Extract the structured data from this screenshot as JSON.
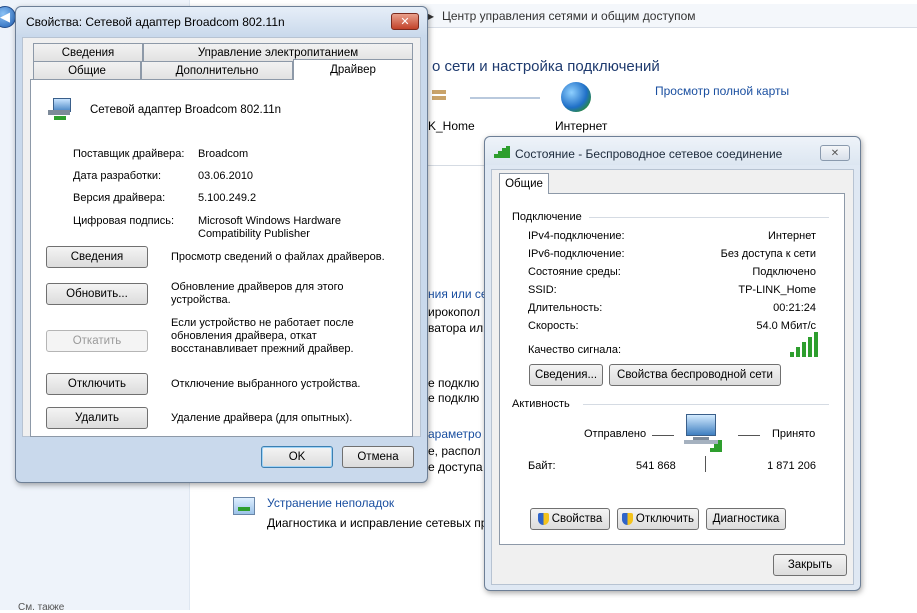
{
  "background": {
    "breadcrumb": "Центр управления сетями и общим доступом",
    "heading": "о сети и настройка подключений",
    "map_link": "Просмотр полной карты",
    "node_home": "K_Home",
    "node_internet": "Интернет",
    "frag1": "ния или се",
    "frag2": "ирокопол",
    "frag3": "ватора ил",
    "frag4": "е подклю",
    "frag5": "е подклю",
    "frag6": "араметро",
    "frag7": "е, распол",
    "frag8": "е доступа",
    "troubleshoot_link": "Устранение неполадок",
    "troubleshoot_desc": "Диагностика и исправление сетевых пр",
    "see_also": "См. также"
  },
  "props": {
    "title": "Свойства: Сетевой адаптер Broadcom 802.11n",
    "tabs_top": [
      "Сведения",
      "Управление электропитанием"
    ],
    "tabs_bottom": [
      "Общие",
      "Дополнительно",
      "Драйвер"
    ],
    "device_name": "Сетевой адаптер Broadcom 802.11n",
    "info": [
      {
        "label": "Поставщик драйвера:",
        "value": "Broadcom"
      },
      {
        "label": "Дата разработки:",
        "value": "03.06.2010"
      },
      {
        "label": "Версия драйвера:",
        "value": "5.100.249.2"
      },
      {
        "label": "Цифровая подпись:",
        "value": "Microsoft Windows Hardware Compatibility Publisher"
      }
    ],
    "actions": [
      {
        "button": "Сведения",
        "desc": "Просмотр сведений о файлах драйверов."
      },
      {
        "button": "Обновить...",
        "desc": "Обновление драйверов для этого устройства."
      },
      {
        "button": "Откатить",
        "desc": "Если устройство не работает после обновления драйвера, откат восстанавливает прежний драйвер."
      },
      {
        "button": "Отключить",
        "desc": "Отключение выбранного устройства."
      },
      {
        "button": "Удалить",
        "desc": "Удаление драйвера (для опытных)."
      }
    ],
    "ok": "OK",
    "cancel": "Отмена",
    "close_glyph": "✕"
  },
  "status": {
    "title": "Состояние - Беспроводное сетевое соединение",
    "tab": "Общие",
    "connection_header": "Подключение",
    "rows": [
      {
        "label": "IPv4-подключение:",
        "value": "Интернет"
      },
      {
        "label": "IPv6-подключение:",
        "value": "Без доступа к сети"
      },
      {
        "label": "Состояние среды:",
        "value": "Подключено"
      },
      {
        "label": "SSID:",
        "value": "TP-LINK_Home"
      },
      {
        "label": "Длительность:",
        "value": "00:21:24"
      },
      {
        "label": "Скорость:",
        "value": "54.0 Мбит/с"
      }
    ],
    "signal_label": "Качество сигнала:",
    "signal_bars": 5,
    "details_button": "Сведения...",
    "wireless_props_button": "Свойства беспроводной сети",
    "activity_header": "Активность",
    "sent_label": "Отправлено",
    "received_label": "Принято",
    "bytes_label": "Байт:",
    "bytes_sent": "541 868",
    "bytes_received": "1 871 206",
    "properties_button": "Свойства",
    "disable_button": "Отключить",
    "diagnose_button": "Диагностика",
    "close_button": "Закрыть",
    "close_glyph": "✕",
    "green": "#2e9e2e"
  }
}
